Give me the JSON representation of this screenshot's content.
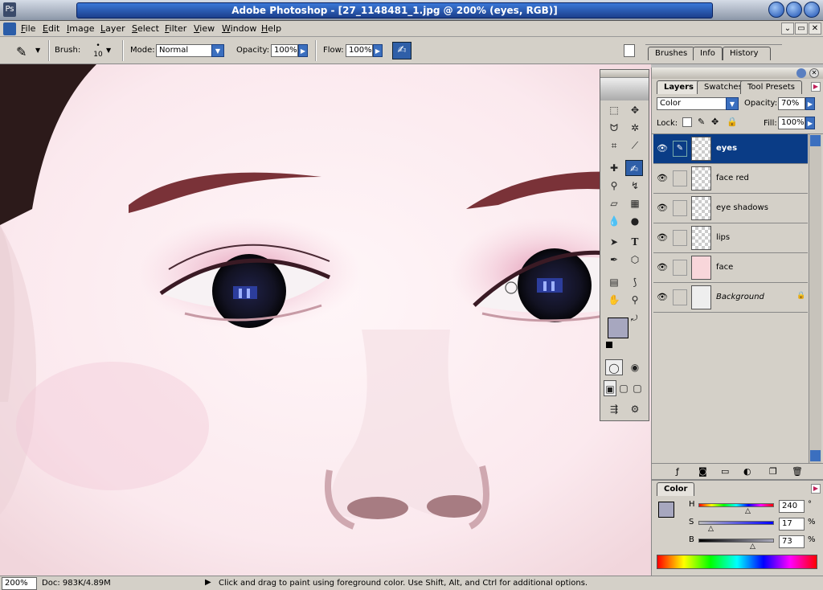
{
  "window": {
    "title": "Adobe Photoshop - [27_1148481_1.jpg @ 200% (eyes, RGB)]",
    "icon": "photoshop-app-icon"
  },
  "menu": [
    "File",
    "Edit",
    "Image",
    "Layer",
    "Select",
    "Filter",
    "View",
    "Window",
    "Help"
  ],
  "options": {
    "brush_label": "Brush:",
    "brush_size": "10",
    "mode_label": "Mode:",
    "mode_value": "Normal",
    "opacity_label": "Opacity:",
    "opacity_value": "100%",
    "flow_label": "Flow:",
    "flow_value": "100%"
  },
  "palette_well_tabs": [
    "Brushes",
    "Info",
    "History"
  ],
  "layers_panel": {
    "tabs": [
      "Layers",
      "Swatches",
      "Tool Presets"
    ],
    "blend_mode": "Color",
    "opacity_label": "Opacity:",
    "opacity": "70%",
    "lock_label": "Lock:",
    "fill_label": "Fill:",
    "fill": "100%",
    "layers": [
      {
        "name": "eyes",
        "selected": true
      },
      {
        "name": "face red",
        "selected": false
      },
      {
        "name": "eye shadows",
        "selected": false
      },
      {
        "name": "lips",
        "selected": false
      },
      {
        "name": "face",
        "selected": false
      },
      {
        "name": "Background",
        "selected": false,
        "locked": true
      }
    ]
  },
  "color_panel": {
    "tab": "Color",
    "h_label": "H",
    "h": "240",
    "h_unit": "°",
    "s_label": "S",
    "s": "17",
    "s_unit": "%",
    "b_label": "B",
    "b": "73",
    "b_unit": "%",
    "foreground": "#a7a7bf",
    "background": "#ffffff"
  },
  "status": {
    "zoom": "200%",
    "doc": "Doc: 983K/4.89M",
    "hint": "Click and drag to paint using foreground color.  Use Shift, Alt, and Ctrl for additional options."
  },
  "colors": {
    "selection": "#0a3c86",
    "title_blue": "#1c3f8c",
    "skin": "#fbeff2"
  }
}
